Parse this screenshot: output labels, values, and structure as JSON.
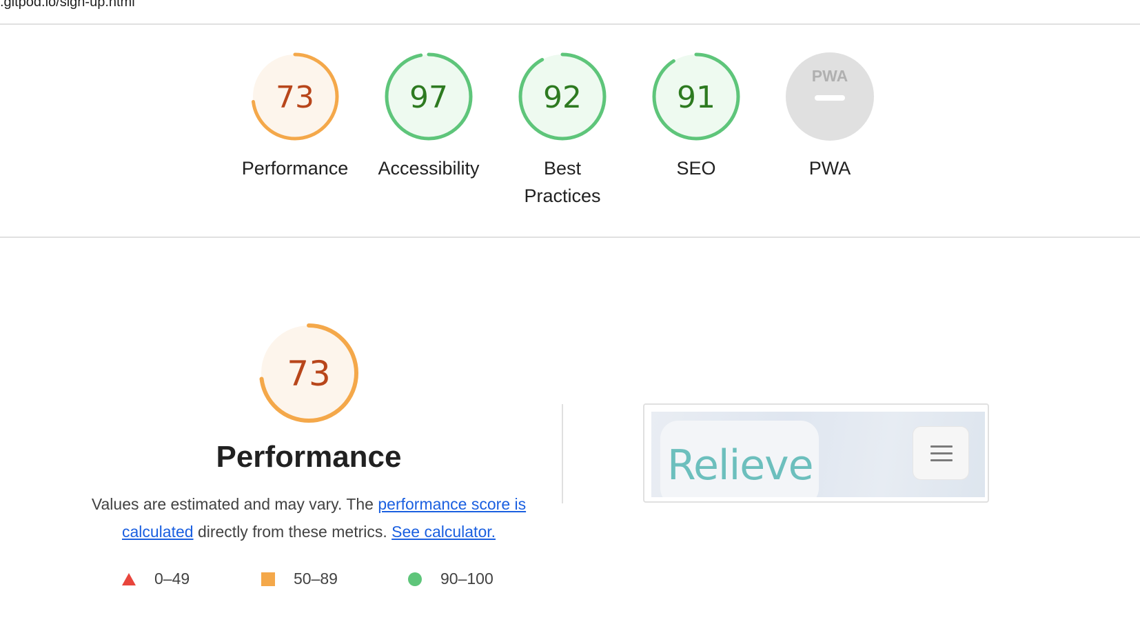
{
  "header": {
    "url": ".gitpod.io/sign-up.html"
  },
  "colors": {
    "fail": "#e8453c",
    "average": "#f4a84a",
    "average_text": "#b8461b",
    "average_bg": "#fdf5ec",
    "pass": "#5ec57a",
    "pass_text": "#2d7a20",
    "pass_bg": "#eefaf0",
    "na": "#e0e0e0",
    "link": "#1a5fe0"
  },
  "gauges": [
    {
      "label": "Performance",
      "score": "73",
      "value": 73,
      "rating": "average",
      "icon": "gauge-ring"
    },
    {
      "label": "Accessibility",
      "score": "97",
      "value": 97,
      "rating": "pass",
      "icon": "gauge-ring"
    },
    {
      "label_line1": "Best",
      "label_line2": "Practices",
      "score": "92",
      "value": 92,
      "rating": "pass",
      "icon": "gauge-ring"
    },
    {
      "label": "SEO",
      "score": "91",
      "value": 91,
      "rating": "pass",
      "icon": "gauge-ring"
    },
    {
      "label": "PWA",
      "badge": "PWA",
      "rating": "na",
      "icon": "pwa-badge-icon"
    }
  ],
  "performance": {
    "score": "73",
    "value": 73,
    "title": "Performance",
    "desc_prefix": "Values are estimated and may vary. The ",
    "link_score": "performance score is calculated",
    "desc_middle": " directly from these metrics. ",
    "link_calculator": "See calculator."
  },
  "legend": [
    {
      "range": "0–49",
      "icon": "fail-triangle-icon"
    },
    {
      "range": "50–89",
      "icon": "average-square-icon"
    },
    {
      "range": "90–100",
      "icon": "pass-circle-icon"
    }
  ],
  "screenshot": {
    "logo_text": "Relieve",
    "menu_icon": "hamburger-menu-icon"
  }
}
